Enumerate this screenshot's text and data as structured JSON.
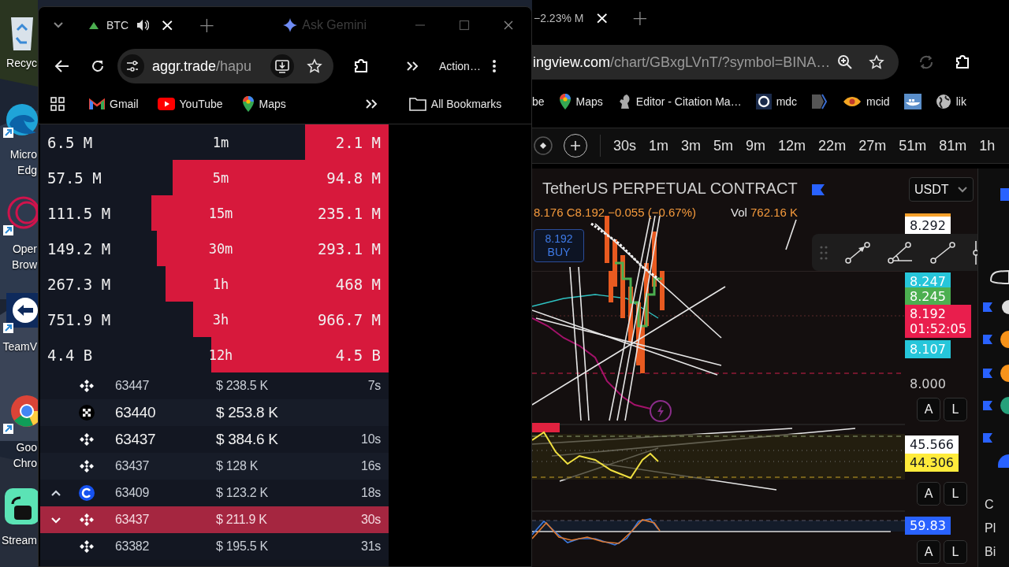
{
  "desktop": {
    "icons": [
      {
        "kind": "recycle-bin",
        "lines": [
          "Recyc"
        ]
      },
      {
        "kind": "edge",
        "lines": [
          "Micro",
          "Edg"
        ]
      },
      {
        "kind": "opera",
        "lines": [
          "Oper",
          "Brow"
        ]
      },
      {
        "kind": "teamviewer",
        "lines": [
          "TeamV"
        ]
      },
      {
        "kind": "chrome",
        "lines": [
          "Goo",
          "Chro"
        ]
      },
      {
        "kind": "stream",
        "lines": [
          "Stream"
        ]
      }
    ]
  },
  "back_window": {
    "tab": {
      "title": "−2.23% M",
      "close": "×"
    },
    "new_tab": "+",
    "address": {
      "domain": "ingview.com",
      "path": "/chart/GBxgLVnT/?symbol=BINA…"
    },
    "bookmarks": [
      {
        "kind": "text",
        "label": "be"
      },
      {
        "kind": "maps",
        "label": "Maps"
      },
      {
        "kind": "squirrel",
        "label": "Editor - Citation Ma…"
      },
      {
        "kind": "ring",
        "label": "mdc"
      },
      {
        "kind": "tag"
      },
      {
        "kind": "eye",
        "label": "mcid"
      },
      {
        "kind": "whale"
      },
      {
        "kind": "globe",
        "label": "lik"
      }
    ],
    "timeframes": [
      "30s",
      "1m",
      "3m",
      "5m",
      "9m",
      "12m",
      "22m",
      "27m",
      "51m",
      "81m",
      "1h"
    ],
    "chart": {
      "title": "TetherUS PERPETUAL CONTRACT",
      "ohlc": "8.176 C8.192 −0.055 (−0.67%)",
      "vol_label": "Vol",
      "volume": "762.16 K",
      "order": {
        "price": "8.192",
        "side": "BUY"
      },
      "currency": "USDT",
      "price_labels": [
        {
          "kind": "high",
          "value": "8.292",
          "color": "#ffffff"
        },
        {
          "kind": "tag",
          "value": "8.247",
          "color": "#26c6da"
        },
        {
          "kind": "tag",
          "value": "8.245",
          "color": "#4caf50"
        },
        {
          "kind": "last",
          "value": "8.192",
          "countdown": "01:52:05",
          "color": "#e91e4d"
        },
        {
          "kind": "tag",
          "value": "8.107",
          "color": "#26c6da"
        },
        {
          "kind": "plain",
          "value": "8.000"
        },
        {
          "kind": "tag",
          "value": "45.566",
          "color": "#ffffff"
        },
        {
          "kind": "tag",
          "value": "44.306",
          "color": "#ffeb3b"
        },
        {
          "kind": "tag",
          "value": "59.83",
          "color": "#2962ff"
        }
      ],
      "panes": [
        {
          "buttons": [
            "A",
            "L"
          ]
        },
        {
          "buttons": [
            "A",
            "L"
          ]
        },
        {
          "buttons": [
            "A",
            "L"
          ]
        }
      ],
      "sidebar_texts": [
        "C",
        "Pl",
        "Bi"
      ]
    }
  },
  "front_window": {
    "tab": {
      "title": "BTC",
      "close": "×"
    },
    "new_tab": "+",
    "gemini": "Ask Gemini",
    "address": {
      "domain": "aggr.trade",
      "path": "/hapu"
    },
    "actions": "Action…",
    "bookmarks": [
      {
        "kind": "gmail",
        "label": "Gmail"
      },
      {
        "kind": "youtube",
        "label": "YouTube"
      },
      {
        "kind": "maps",
        "label": "Maps"
      }
    ],
    "all_bookmarks": "All Bookmarks",
    "stats": [
      {
        "buy": "6.5 M",
        "timeframe": "1m",
        "sell": "2.1 M",
        "level": 0.24
      },
      {
        "buy": "57.5 M",
        "timeframe": "5m",
        "sell": "94.8 M",
        "level": 0.62
      },
      {
        "buy": "111.5 M",
        "timeframe": "15m",
        "sell": "235.1 M",
        "level": 0.68
      },
      {
        "buy": "149.2 M",
        "timeframe": "30m",
        "sell": "293.1 M",
        "level": 0.665
      },
      {
        "buy": "267.3 M",
        "timeframe": "1h",
        "sell": "468 M",
        "level": 0.64
      },
      {
        "buy": "751.9 M",
        "timeframe": "3h",
        "sell": "966.7 M",
        "level": 0.56
      },
      {
        "buy": "4.4 B",
        "timeframe": "12h",
        "sell": "4.5 B",
        "level": 0.51
      }
    ],
    "trades": [
      {
        "kind": "binance",
        "caret_up": false,
        "caret_down": false,
        "price": "63447",
        "amount": "$ 238.5 K",
        "age": "7s",
        "large": false,
        "highlighted": false
      },
      {
        "kind": "okx",
        "caret_up": false,
        "caret_down": false,
        "price": "63440",
        "amount": "$ 253.8 K",
        "large": true,
        "highlighted": false
      },
      {
        "kind": "binance",
        "caret_up": false,
        "caret_down": false,
        "price": "63437",
        "amount": "$ 384.6 K",
        "age": "10s",
        "large": true,
        "highlighted": false
      },
      {
        "kind": "binance",
        "caret_up": false,
        "caret_down": false,
        "price": "63437",
        "amount": "$ 128 K",
        "age": "16s",
        "large": false,
        "highlighted": false
      },
      {
        "kind": "coinbase",
        "caret_up": true,
        "caret_down": false,
        "price": "63409",
        "amount": "$ 123.2 K",
        "age": "18s",
        "large": false,
        "highlighted": false
      },
      {
        "kind": "binance",
        "caret_up": false,
        "caret_down": true,
        "price": "63437",
        "amount": "$ 211.9 K",
        "age": "30s",
        "large": false,
        "highlighted": true
      },
      {
        "kind": "binance",
        "caret_up": false,
        "caret_down": false,
        "price": "63382",
        "amount": "$ 195.5 K",
        "age": "31s",
        "large": false,
        "highlighted": false
      }
    ]
  }
}
